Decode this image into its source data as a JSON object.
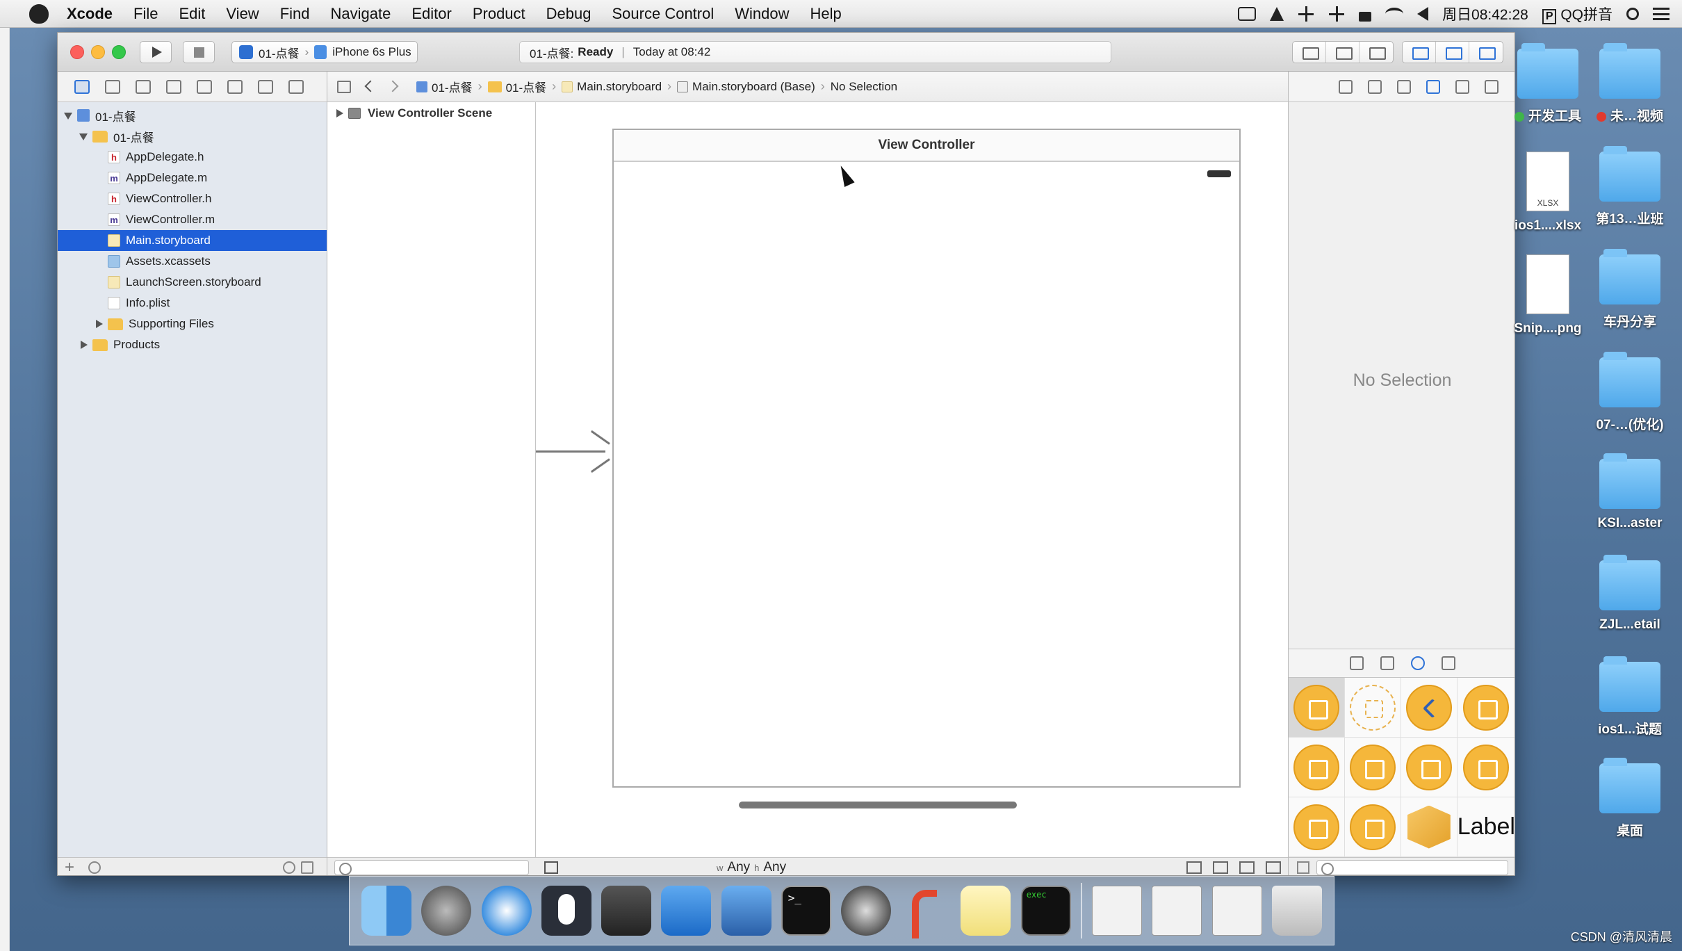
{
  "menubar": {
    "app_name": "Xcode",
    "items": [
      "File",
      "Edit",
      "View",
      "Find",
      "Navigate",
      "Editor",
      "Product",
      "Debug",
      "Source Control",
      "Window",
      "Help"
    ],
    "clock": "周日08:42:28",
    "ime_label": "QQ拼音",
    "ime_badge": "P"
  },
  "toolbar": {
    "scheme_target": "01-点餐",
    "scheme_device": "iPhone 6s Plus",
    "activity_project": "01-点餐:",
    "activity_status": "Ready",
    "activity_divider": "|",
    "activity_time": "Today at 08:42"
  },
  "navigator": {
    "tree": [
      {
        "label": "01-点餐",
        "indent": 1,
        "icon": "project",
        "disclosure": "open",
        "selected": false
      },
      {
        "label": "01-点餐",
        "indent": 2,
        "icon": "folder",
        "disclosure": "open",
        "selected": false
      },
      {
        "label": "AppDelegate.h",
        "indent": 3,
        "icon": "h",
        "disclosure": "",
        "selected": false
      },
      {
        "label": "AppDelegate.m",
        "indent": 3,
        "icon": "m",
        "disclosure": "",
        "selected": false
      },
      {
        "label": "ViewController.h",
        "indent": 3,
        "icon": "h",
        "disclosure": "",
        "selected": false
      },
      {
        "label": "ViewController.m",
        "indent": 3,
        "icon": "m",
        "disclosure": "",
        "selected": false
      },
      {
        "label": "Main.storyboard",
        "indent": 3,
        "icon": "storyboard",
        "disclosure": "",
        "selected": true
      },
      {
        "label": "Assets.xcassets",
        "indent": 3,
        "icon": "assets",
        "disclosure": "",
        "selected": false
      },
      {
        "label": "LaunchScreen.storyboard",
        "indent": 3,
        "icon": "storyboard",
        "disclosure": "",
        "selected": false
      },
      {
        "label": "Info.plist",
        "indent": 3,
        "icon": "plist",
        "disclosure": "",
        "selected": false
      },
      {
        "label": "Supporting Files",
        "indent": 3,
        "icon": "folder",
        "disclosure": "closed",
        "selected": false
      },
      {
        "label": "Products",
        "indent": 2,
        "icon": "folder",
        "disclosure": "closed",
        "selected": false
      }
    ],
    "add_label": "+"
  },
  "jumpbar": {
    "crumbs": [
      {
        "label": "01-点餐",
        "icon": "blue"
      },
      {
        "label": "01-点餐",
        "icon": "yel"
      },
      {
        "label": "Main.storyboard",
        "icon": "sb"
      },
      {
        "label": "Main.storyboard (Base)",
        "icon": "sbb"
      },
      {
        "label": "No Selection",
        "icon": ""
      }
    ]
  },
  "outline": {
    "scene_label": "View Controller Scene"
  },
  "canvas": {
    "vc_title": "View Controller"
  },
  "editor_footer": {
    "w_prefix": "w",
    "w_value": "Any",
    "h_prefix": "h",
    "h_value": "Any"
  },
  "inspector": {
    "no_selection": "No Selection",
    "library_label_item": "Label"
  },
  "desktop": {
    "icons": [
      {
        "label": "开发工具",
        "kind": "folder",
        "dot": "#3fb54a",
        "col": 0,
        "row": 0
      },
      {
        "label": "未…视频",
        "kind": "folder",
        "dot": "#e23a2e",
        "col": 1,
        "row": 0
      },
      {
        "label": "ios1....xlsx",
        "kind": "xlsx",
        "dot": "",
        "col": 0,
        "row": 1
      },
      {
        "label": "第13…业班",
        "kind": "folder",
        "dot": "",
        "col": 1,
        "row": 1
      },
      {
        "label": "Snip....png",
        "kind": "png",
        "dot": "",
        "col": 0,
        "row": 2
      },
      {
        "label": "车丹分享",
        "kind": "folder",
        "dot": "",
        "col": 1,
        "row": 2
      },
      {
        "label": "07-…(优化)",
        "kind": "folder",
        "dot": "",
        "col": 1,
        "row": 3
      },
      {
        "label": "KSI...aster",
        "kind": "folder",
        "dot": "",
        "col": 1,
        "row": 4
      },
      {
        "label": "ZJL...etail",
        "kind": "folder",
        "dot": "",
        "col": 1,
        "row": 5
      },
      {
        "label": "ios1...试题",
        "kind": "folder",
        "dot": "",
        "col": 1,
        "row": 6
      },
      {
        "label": "桌面",
        "kind": "folder",
        "dot": "",
        "col": 1,
        "row": 7
      }
    ],
    "xlsx_tag": "XLSX"
  },
  "watermark": "CSDN @清风清晨"
}
